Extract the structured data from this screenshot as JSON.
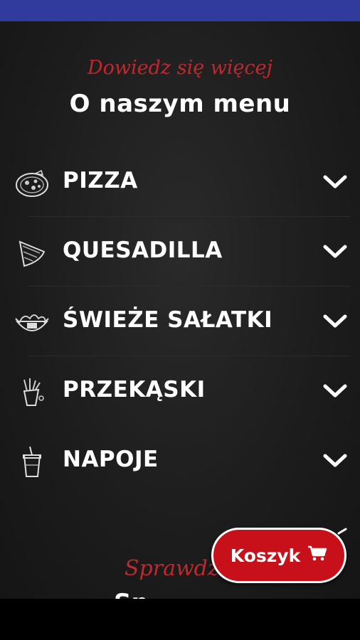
{
  "header": {
    "subtitle": "Dowiedz się więcej",
    "title": "O naszym menu"
  },
  "menu": {
    "items": [
      {
        "label": "PIZZA",
        "icon": "pizza-icon"
      },
      {
        "label": "QUESADILLA",
        "icon": "quesadilla-icon"
      },
      {
        "label": "ŚWIEŻE SAŁATKI",
        "icon": "salad-icon"
      },
      {
        "label": "PRZEKĄSKI",
        "icon": "snacks-icon"
      },
      {
        "label": "NAPOJE",
        "icon": "drink-icon"
      }
    ]
  },
  "cta": {
    "subtitle": "Sprawdź",
    "title_partial": "Sp"
  },
  "cart": {
    "label": "Koszyk",
    "icon": "cart-icon"
  },
  "colors": {
    "accent_red": "#c0282d",
    "button_red": "#c8101a",
    "status_bar": "#2f3c9e",
    "background": "#1f1f1f"
  }
}
